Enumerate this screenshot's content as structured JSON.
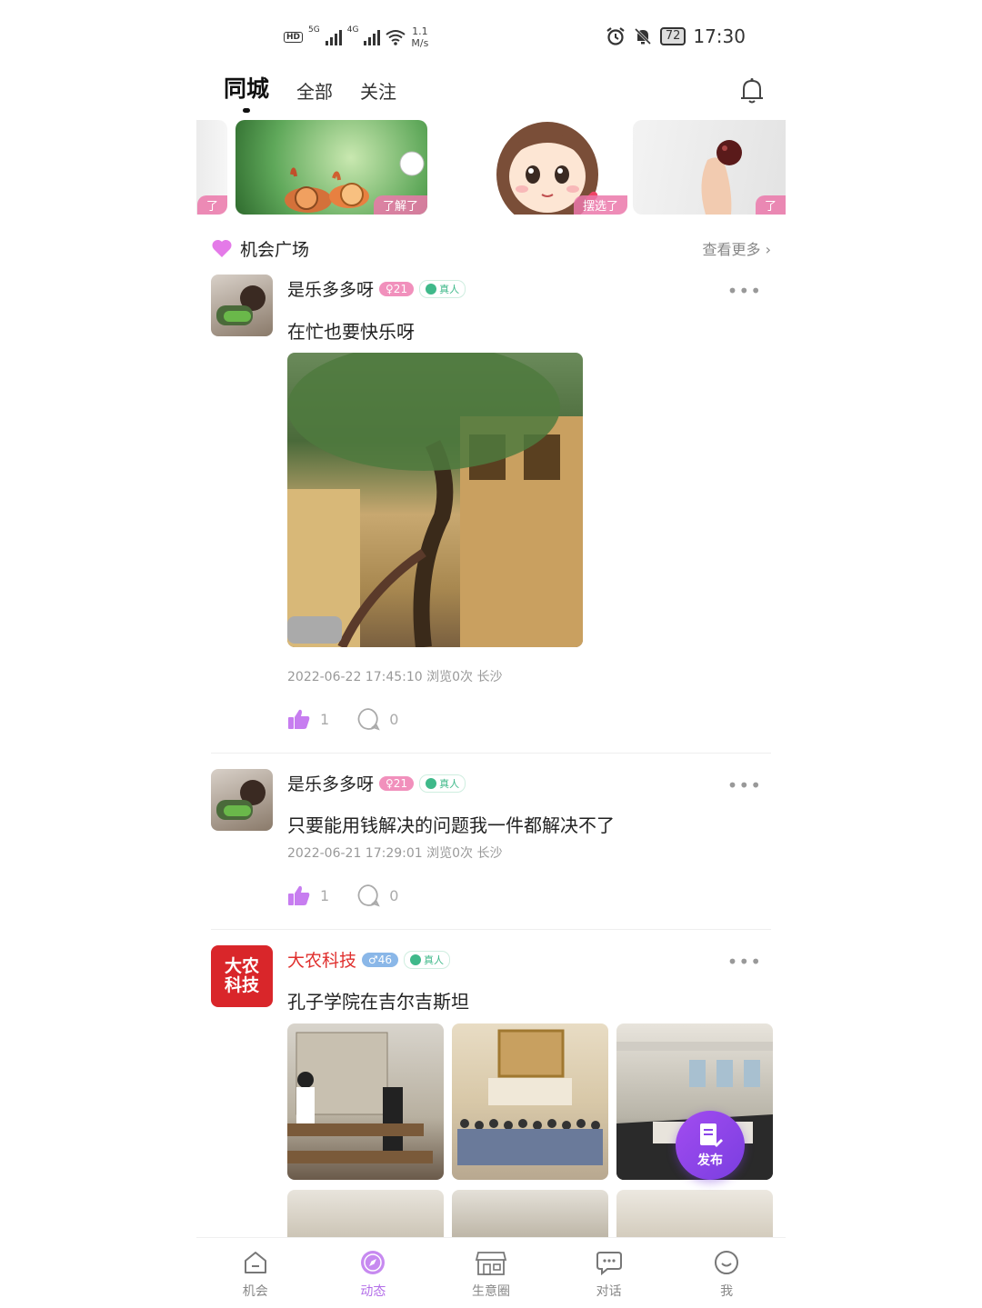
{
  "status_bar": {
    "hd": "HD",
    "net1": "5G",
    "net2": "4G",
    "speed_value": "1.1",
    "speed_unit": "M/s",
    "battery": "72",
    "time": "17:30"
  },
  "tabs": [
    {
      "label": "同城",
      "active": true
    },
    {
      "label": "全部",
      "active": false
    },
    {
      "label": "关注",
      "active": false
    }
  ],
  "banner": {
    "cards": [
      {
        "tag": "了"
      },
      {
        "tag": "了解了"
      },
      {
        "tag": "摆选了"
      },
      {
        "tag": "了"
      }
    ]
  },
  "section": {
    "title": "机会广场",
    "more": "查看更多 ›"
  },
  "posts": [
    {
      "name": "是乐多多呀",
      "age": "♀21",
      "verified": "真人",
      "more": "•••",
      "content": "在忙也要快乐呀",
      "meta": "2022-06-22 17:45:10  浏览0次  长沙",
      "likes": "1",
      "comments": "0"
    },
    {
      "name": "是乐多多呀",
      "age": "♀21",
      "verified": "真人",
      "more": "•••",
      "content": "只要能用钱解决的问题我一件都解决不了",
      "meta": "2022-06-21 17:29:01  浏览0次  长沙",
      "likes": "1",
      "comments": "0"
    },
    {
      "name": "大农科技",
      "avatar_text": "大农\n科技",
      "age": "♂46",
      "verified": "真人",
      "more": "•••",
      "content": "孔子学院在吉尔吉斯坦"
    }
  ],
  "fab": {
    "label": "发布"
  },
  "nav": [
    {
      "label": "机会",
      "icon": "home-icon",
      "active": false
    },
    {
      "label": "动态",
      "icon": "compass-icon",
      "active": true
    },
    {
      "label": "生意圈",
      "icon": "shop-icon",
      "active": false
    },
    {
      "label": "对话",
      "icon": "chat-icon",
      "active": false
    },
    {
      "label": "我",
      "icon": "smile-icon",
      "active": false
    }
  ],
  "colors": {
    "accent": "#b36ee8",
    "like": "#c77df0",
    "brand_red": "#d9262a"
  }
}
